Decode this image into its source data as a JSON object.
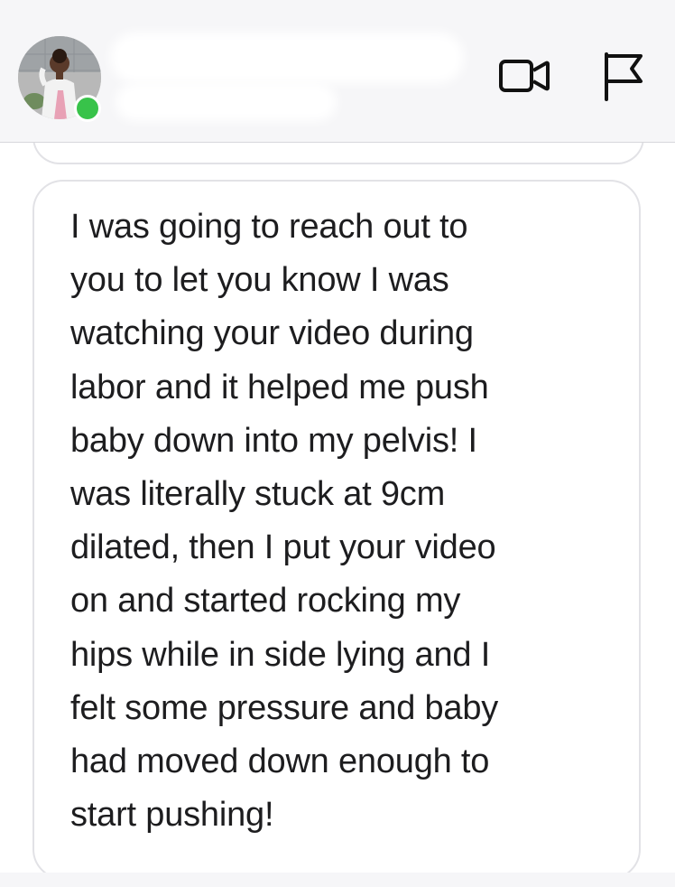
{
  "header": {
    "contact_name": "",
    "contact_status": "",
    "presence": "online",
    "presence_color": "#38c34a",
    "video_call_icon": "video-camera-icon",
    "report_icon": "flag-icon"
  },
  "conversation": {
    "message": {
      "lines": [
        "I was going to reach out to",
        "you to let you know I was",
        "watching your video during",
        "labor and it helped me push",
        "baby down into my pelvis! I",
        "was literally stuck at 9cm",
        "dilated, then I put your video",
        "on and started rocking my",
        "hips while in side lying and I",
        "felt some pressure and baby",
        "had moved down enough to",
        "start pushing!"
      ]
    }
  }
}
